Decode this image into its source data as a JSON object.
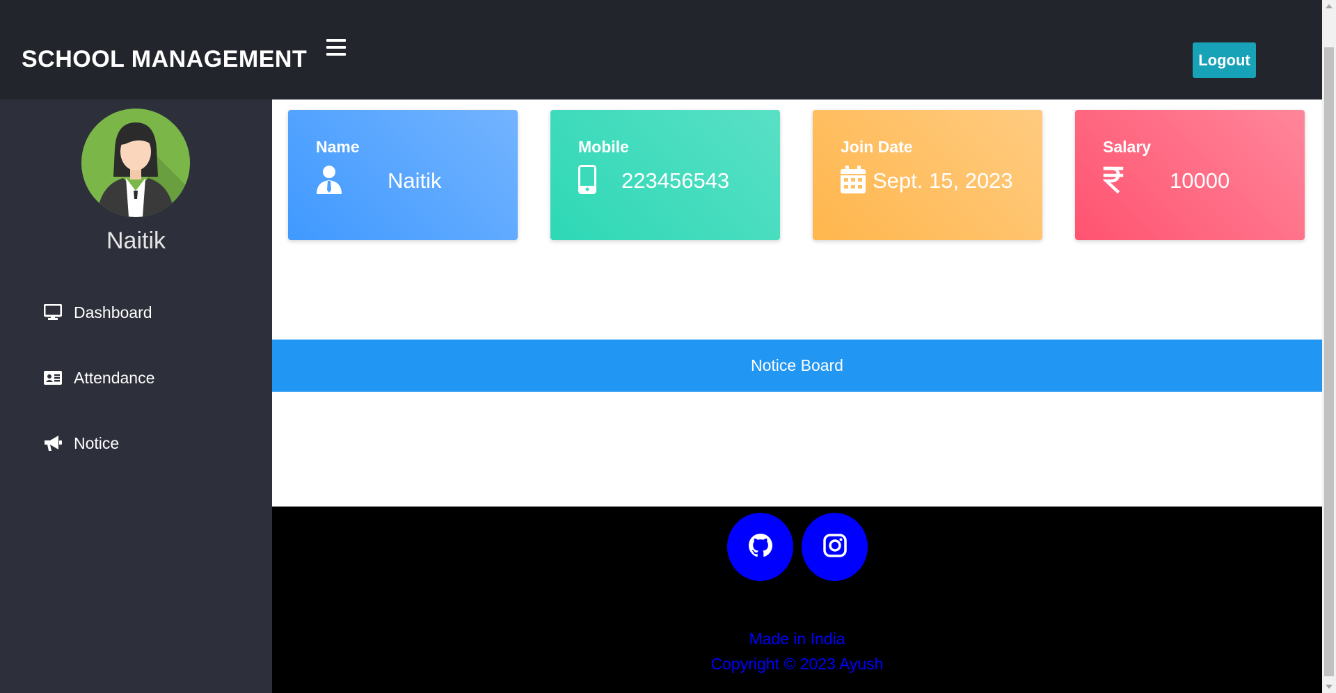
{
  "header": {
    "brand": "SCHOOL MANAGEMENT",
    "logout_label": "Logout"
  },
  "sidebar": {
    "user_name": "Naitik",
    "items": [
      {
        "label": "Dashboard",
        "icon": "desktop-icon"
      },
      {
        "label": "Attendance",
        "icon": "id-card-icon"
      },
      {
        "label": "Notice",
        "icon": "bullhorn-icon"
      }
    ]
  },
  "cards": [
    {
      "title": "Name",
      "value": "Naitik",
      "icon": "user-tie-icon",
      "color": "#4099ff"
    },
    {
      "title": "Mobile",
      "value": "223456543",
      "icon": "mobile-icon",
      "color": "#2ed8b6"
    },
    {
      "title": "Join Date",
      "value": "Sept. 15, 2023",
      "icon": "calendar-icon",
      "color": "#ffb64d"
    },
    {
      "title": "Salary",
      "value": "10000",
      "icon": "rupee-icon",
      "color": "#ff5370"
    }
  ],
  "notice_board": {
    "title": "Notice Board"
  },
  "footer": {
    "social": [
      {
        "icon": "github-icon"
      },
      {
        "icon": "instagram-icon"
      }
    ],
    "made_in": "Made in India",
    "copyright": "Copyright © 2023 Ayush"
  }
}
